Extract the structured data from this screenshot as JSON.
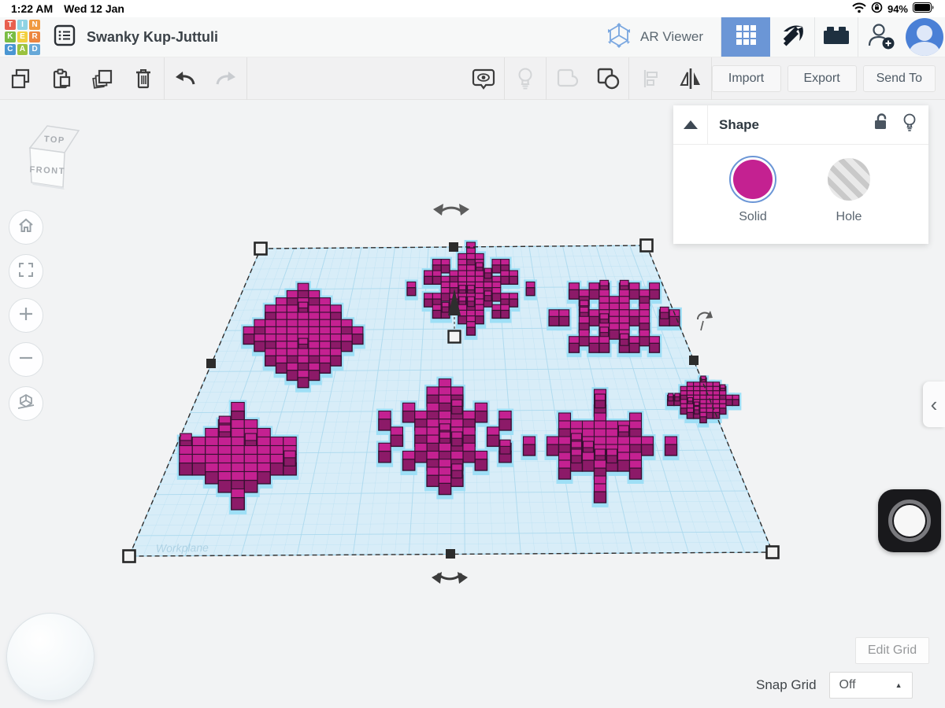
{
  "status_bar": {
    "time": "1:22 AM",
    "date": "Wed 12 Jan",
    "battery_percent": "94%"
  },
  "logo": {
    "tiles": [
      {
        "ch": "T",
        "color": "#e8604f"
      },
      {
        "ch": "I",
        "color": "#8fd3e3"
      },
      {
        "ch": "N",
        "color": "#f0993f"
      },
      {
        "ch": "K",
        "color": "#79bc43"
      },
      {
        "ch": "E",
        "color": "#f2cf3e"
      },
      {
        "ch": "R",
        "color": "#ec8540"
      },
      {
        "ch": "C",
        "color": "#4a96d2"
      },
      {
        "ch": "A",
        "color": "#9ac23f"
      },
      {
        "ch": "D",
        "color": "#66a8d8"
      }
    ]
  },
  "header": {
    "title": "Swanky Kup-Juttuli",
    "ar_viewer_label": "AR Viewer"
  },
  "toolbar": {
    "import_label": "Import",
    "export_label": "Export",
    "send_to_label": "Send To"
  },
  "viewcube": {
    "top_label": "TOP",
    "front_label": "FRONT"
  },
  "shape_panel": {
    "title": "Shape",
    "options": [
      {
        "label": "Solid"
      },
      {
        "label": "Hole"
      }
    ]
  },
  "canvas": {
    "workplane_watermark": "Workplane"
  },
  "footer": {
    "edit_grid_label": "Edit Grid",
    "snap_grid_label": "Snap Grid",
    "snap_grid_value": "Off"
  },
  "colors": {
    "accent_blue": "#6b96d6",
    "solid_pink": "#c42191",
    "solid_pink_dark": "#8c1a68",
    "solid_outline": "#371031",
    "halo_blue": "#9edff6",
    "workplane_fill": "#d8edf8",
    "workplane_line": "#aad9ee",
    "workplane_line_major": "#8fcbe6",
    "selection_dark": "#2c2c2c"
  }
}
